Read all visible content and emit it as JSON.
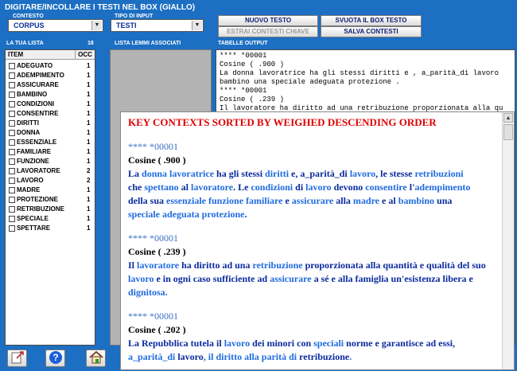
{
  "title": "DIGITARE/INCOLLARE I TESTI NEL BOX (GIALLO)",
  "contesto": {
    "label": "CONTESTO",
    "value": "CORPUS"
  },
  "tipo_input": {
    "label": "TIPO DI INPUT",
    "value": "TESTI"
  },
  "buttons": {
    "nuovo_testo": "NUOVO TESTO",
    "svuota": "SVUOTA IL BOX TESTO",
    "estrai": "ESTRAI CONTESTI CHIAVE",
    "salva": "SALVA CONTESTI"
  },
  "section_labels": {
    "tua_lista": "LA TUA LISTA",
    "tua_lista_count": "18",
    "lemmi": "LISTA LEMMI ASSOCIATI",
    "tabelle": "TABELLE  OUTPUT"
  },
  "list": {
    "headers": {
      "item": "ITEM",
      "occ": "OCC"
    },
    "rows": [
      {
        "item": "ADEGUATO",
        "occ": "1"
      },
      {
        "item": "ADEMPIMENTO",
        "occ": "1"
      },
      {
        "item": "ASSICURARE",
        "occ": "1"
      },
      {
        "item": "BAMBINO",
        "occ": "1"
      },
      {
        "item": "CONDIZIONI",
        "occ": "1"
      },
      {
        "item": "CONSENTIRE",
        "occ": "1"
      },
      {
        "item": "DIRITTI",
        "occ": "1"
      },
      {
        "item": "DONNA",
        "occ": "1"
      },
      {
        "item": "ESSENZIALE",
        "occ": "1"
      },
      {
        "item": "FAMILIARE",
        "occ": "1"
      },
      {
        "item": "FUNZIONE",
        "occ": "1"
      },
      {
        "item": "LAVORATORE",
        "occ": "2"
      },
      {
        "item": "LAVORO",
        "occ": "2"
      },
      {
        "item": "MADRE",
        "occ": "1"
      },
      {
        "item": "PROTEZIONE",
        "occ": "1"
      },
      {
        "item": "RETRIBUZIONE",
        "occ": "1"
      },
      {
        "item": "SPECIALE",
        "occ": "1"
      },
      {
        "item": "SPETTARE",
        "occ": "1"
      }
    ]
  },
  "output_lines": [
    "****  *00001",
    "Cosine  ( .900 )",
    "La donna lavoratrice ha gli stessi diritti e ,  a_parità_di lavoro",
    "bambino una speciale adeguata protezione .",
    "****  *00001",
    "Cosine  ( .239 )",
    "Il lavoratore ha diritto ad una retribuzione proporzionata alla qu"
  ],
  "popup": {
    "title": "KEY CONTEXTS SORTED BY WEIGHED DESCENDING ORDER",
    "contexts": [
      {
        "id": "**** *00001",
        "cosine": "Cosine ( .900 )"
      },
      {
        "id": "**** *00001",
        "cosine": "Cosine ( .239 )"
      },
      {
        "id": "**** *00001",
        "cosine": "Cosine ( .202 )"
      }
    ],
    "t1": [
      "La ",
      "donna",
      " ",
      "lavoratrice",
      " ha gli stessi ",
      "diritti",
      " e, a_parità_di ",
      "lavoro",
      ", le stesse ",
      "retribuzioni",
      "che ",
      "spettano",
      " al ",
      "lavoratore",
      ". Le ",
      "condizioni",
      " di ",
      "lavoro",
      " devono ",
      "consentire",
      " l'",
      "adempimento",
      "della sua ",
      "essenziale",
      " ",
      "funzione",
      " ",
      "familiare",
      " e ",
      "assicurare",
      " alla ",
      "madre",
      " e al ",
      "bambino",
      " una",
      "speciale",
      " ",
      "adeguata",
      " ",
      "protezione",
      "."
    ],
    "t2": [
      "Il ",
      "lavoratore",
      " ha diritto ad una ",
      "retribuzione",
      " proporzionata alla quantità e qualità del suo",
      "lavoro",
      " e in ogni caso sufficiente ad ",
      "assicurare",
      " a sé e alla famiglia un'esistenza libera e",
      "dignitosa."
    ],
    "t3": [
      "La Repubblica tutela il ",
      "lavoro",
      " dei minori con ",
      "speciali",
      " norme e garantisce ad essi,",
      "a_parità_di ",
      "lavoro",
      ", il diritto alla parità di ",
      "retribuzione",
      "."
    ]
  }
}
